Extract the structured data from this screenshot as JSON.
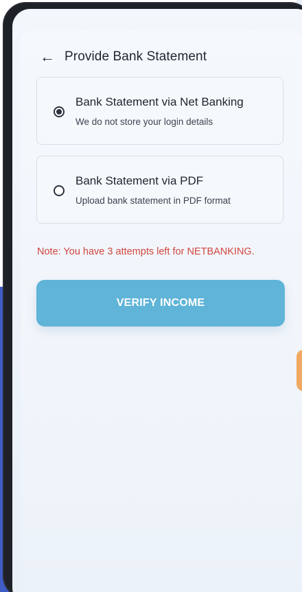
{
  "header": {
    "title": "Provide Bank Statement",
    "back_icon": "arrow-left-icon"
  },
  "options": [
    {
      "title": "Bank Statement via Net Banking",
      "subtitle": "We do not store your login details",
      "selected": true
    },
    {
      "title": "Bank Statement via PDF",
      "subtitle": "Upload bank statement in PDF format",
      "selected": false
    }
  ],
  "note": "Note: You have 3 attempts left for NETBANKING.",
  "verify_button": {
    "label": "VERIFY INCOME"
  },
  "colors": {
    "accent": "#5fb4d8",
    "note_red": "#d0463f",
    "text_dark": "#1f2430",
    "background_blue": "#3f5bc4"
  }
}
